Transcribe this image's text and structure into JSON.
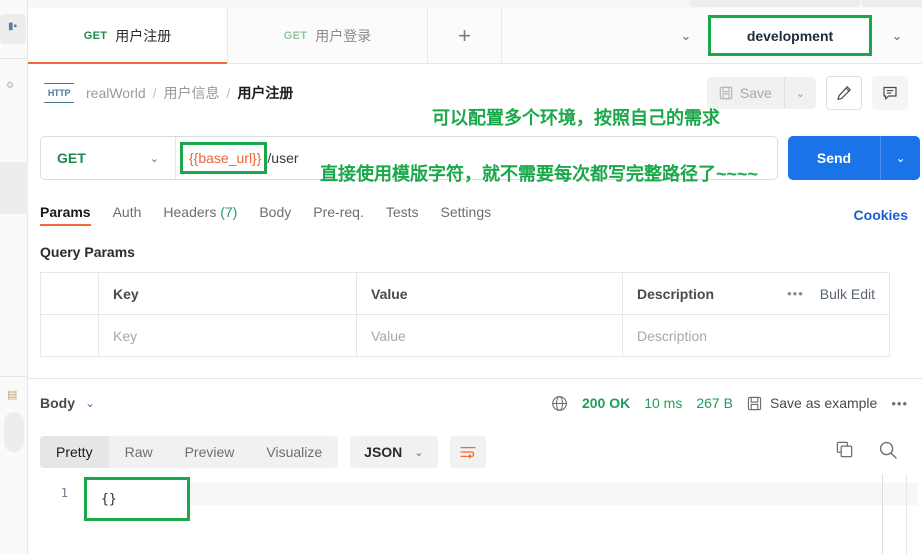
{
  "rail": {
    "glyph_icon": "collections-icon",
    "gear_icon": "gear-icon",
    "doc_icon": "document-icon"
  },
  "tabs": {
    "items": [
      {
        "verb": "GET",
        "label": "用户注册",
        "active": true
      },
      {
        "verb": "GET",
        "label": "用户登录",
        "active": false
      }
    ],
    "new_tab_label": "+",
    "overflow_caret": "⌄"
  },
  "environment": {
    "selected": "development",
    "caret": "⌄"
  },
  "breadcrumb": {
    "badge": "HTTP",
    "items": [
      "realWorld",
      "用户信息",
      "用户注册"
    ],
    "separator": "/"
  },
  "toolbar": {
    "save_label": "Save",
    "save_caret": "⌄",
    "edit_icon": "pencil-icon",
    "comment_icon": "comment-icon"
  },
  "url": {
    "method": "GET",
    "method_caret": "⌄",
    "variable": "{{base_url}}",
    "path": "/user",
    "send_label": "Send",
    "send_caret": "⌄"
  },
  "request_tabs": {
    "items": [
      {
        "label": "Params",
        "count": "",
        "active": true
      },
      {
        "label": "Auth",
        "count": "",
        "active": false
      },
      {
        "label": "Headers",
        "count": "(7)",
        "active": false
      },
      {
        "label": "Body",
        "count": "",
        "active": false
      },
      {
        "label": "Pre-req.",
        "count": "",
        "active": false
      },
      {
        "label": "Tests",
        "count": "",
        "active": false
      },
      {
        "label": "Settings",
        "count": "",
        "active": false
      }
    ],
    "cookies_label": "Cookies"
  },
  "query_params": {
    "title": "Query Params",
    "headers": {
      "key": "Key",
      "value": "Value",
      "description": "Description"
    },
    "placeholders": {
      "key": "Key",
      "value": "Value",
      "description": "Description"
    },
    "dots": "•••",
    "bulk_edit_label": "Bulk Edit"
  },
  "response": {
    "body_label": "Body",
    "body_caret": "⌄",
    "globe_icon": "globe-icon",
    "status": "200 OK",
    "time": "10 ms",
    "size": "267 B",
    "save_example_label": "Save as example",
    "save_icon": "save-icon",
    "kebab": "•••",
    "view_tabs": [
      "Pretty",
      "Raw",
      "Preview",
      "Visualize"
    ],
    "active_view": "Pretty",
    "format": "JSON",
    "format_caret": "⌄",
    "wrap_icon": "wrap-text-icon",
    "copy_icon": "copy-icon",
    "search_icon": "search-icon",
    "line_number": "1",
    "body_content": "{}"
  },
  "annotations": [
    {
      "id": "env",
      "text": "可以配置多个环境，按照自己的需求"
    },
    {
      "id": "url",
      "text": "直接使用模版字符，就不需要每次都写完整路径了~~~~"
    }
  ],
  "colors": {
    "accent_orange": "#ef6b3a",
    "green": "#1aa84a",
    "method_green": "#1e8a4c",
    "send_blue": "#1a73e8",
    "link_blue": "#1a5fd0",
    "variable_orange": "#e8663a",
    "status_green": "#1e9e5a"
  }
}
